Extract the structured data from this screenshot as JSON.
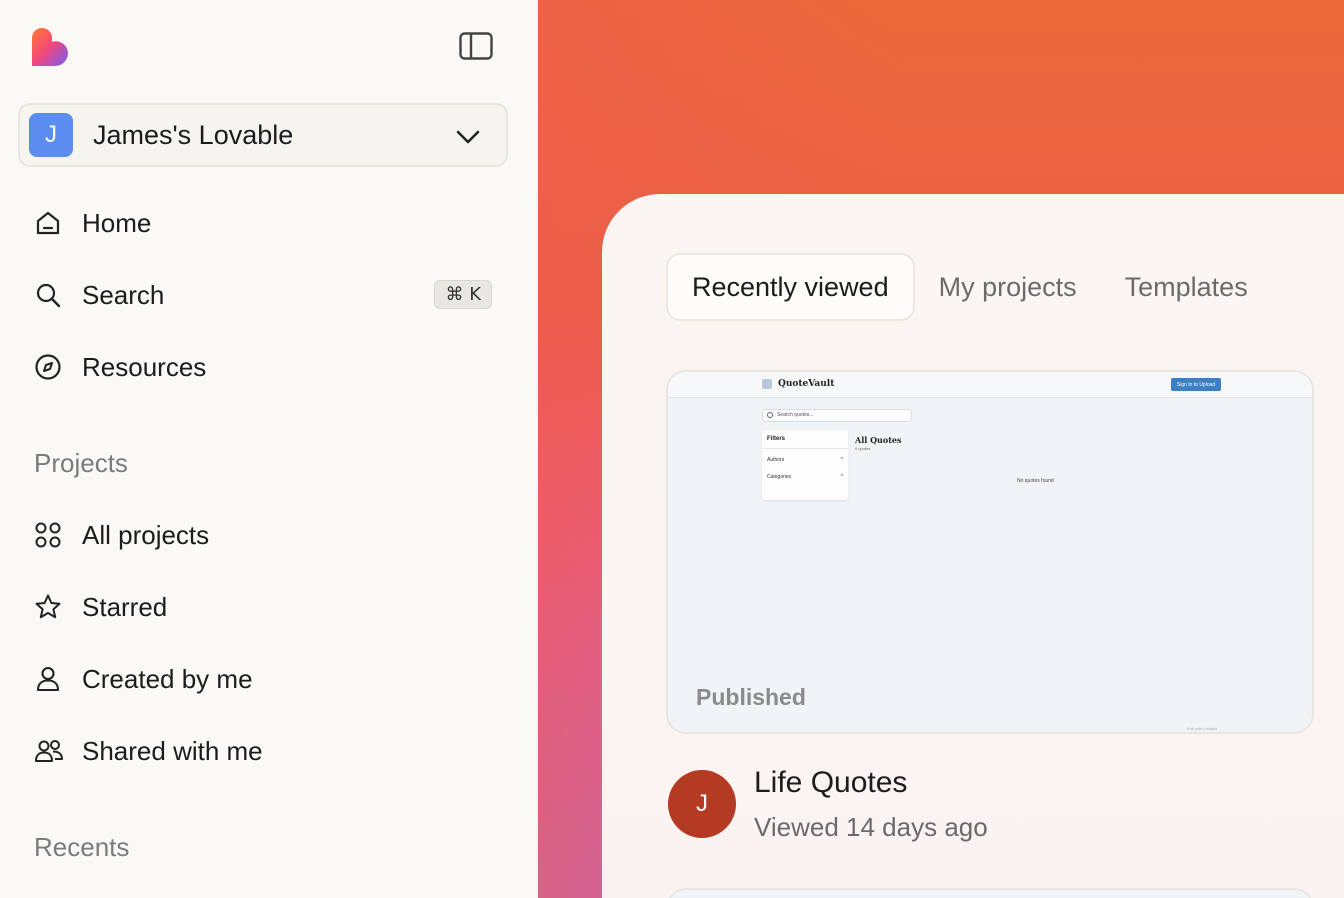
{
  "sidebar": {
    "workspace": {
      "initial": "J",
      "name": "James's Lovable"
    },
    "nav": [
      {
        "label": "Home",
        "icon": "home-icon"
      },
      {
        "label": "Search",
        "icon": "search-icon",
        "shortcut": "⌘ K"
      },
      {
        "label": "Resources",
        "icon": "compass-icon"
      }
    ],
    "projects_label": "Projects",
    "projects": [
      {
        "label": "All projects",
        "icon": "grid-icon"
      },
      {
        "label": "Starred",
        "icon": "star-icon"
      },
      {
        "label": "Created by me",
        "icon": "user-icon"
      },
      {
        "label": "Shared with me",
        "icon": "users-icon"
      }
    ],
    "recents_label": "Recents"
  },
  "main": {
    "tabs": [
      {
        "label": "Recently viewed",
        "active": true
      },
      {
        "label": "My projects",
        "active": false
      },
      {
        "label": "Templates",
        "active": false
      }
    ],
    "project_card": {
      "badge": "Published",
      "thumbnail": {
        "brand": "QuoteVault",
        "sign_in": "Sign In to Upload",
        "search_placeholder": "Search quotes...",
        "filters_title": "Filters",
        "filter_authors": "Authors",
        "filter_categories": "Categories",
        "heading": "All Quotes",
        "count": "0 quotes",
        "empty": "No quotes found",
        "footer": "Edit with Lovable"
      },
      "avatar_initial": "J",
      "title": "Life Quotes",
      "subtitle": "Viewed 14 days ago"
    }
  },
  "colors": {
    "workspace_avatar": "#5b8def",
    "project_avatar": "#b43a23",
    "gradient_top": "#ec6a3a",
    "gradient_bottom": "#c35bd0"
  }
}
